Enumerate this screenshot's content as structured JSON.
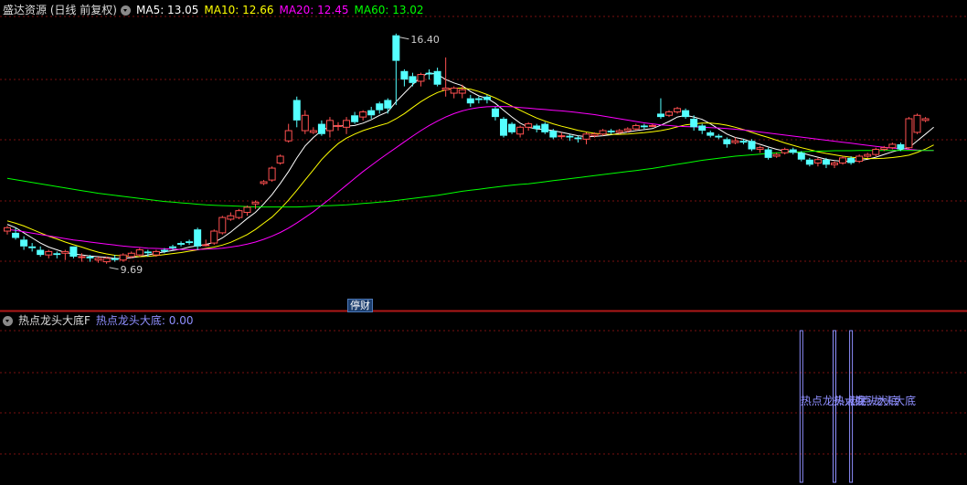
{
  "main_header": {
    "title": "盛达资源 (日线 前复权)",
    "ma": [
      {
        "label": "MA5: 13.05",
        "color": "#ffffff"
      },
      {
        "label": "MA10: 12.66",
        "color": "#ffff00"
      },
      {
        "label": "MA20: 12.45",
        "color": "#ff00ff"
      },
      {
        "label": "MA60: 13.02",
        "color": "#00ff00"
      }
    ]
  },
  "sub_header": {
    "indicator_name": "热点龙头大底F",
    "value_label": "热点龙头大底: 0.00",
    "value_color": "#8f8fff"
  },
  "badge": "停财",
  "signal_text": "热点龙头大底",
  "colors": {
    "up": "#ff5050",
    "down": "#54ffff",
    "grid": "#7a1010",
    "signal": "#8f8fff"
  },
  "chart_data": [
    {
      "type": "candlestick",
      "ylim": [
        8.8,
        16.9
      ],
      "max_label": "16.40",
      "min_label": "9.69",
      "candles": [
        [
          10.65,
          10.75,
          10.55,
          10.8
        ],
        [
          10.6,
          10.45,
          10.4,
          10.75
        ],
        [
          10.4,
          10.2,
          10.1,
          10.5
        ],
        [
          10.2,
          10.15,
          10.05,
          10.3
        ],
        [
          10.1,
          9.95,
          9.9,
          10.2
        ],
        [
          9.95,
          10.05,
          9.85,
          10.1
        ],
        [
          10.0,
          9.95,
          9.85,
          10.05
        ],
        [
          10.0,
          10.05,
          9.8,
          10.1
        ],
        [
          10.2,
          9.9,
          9.85,
          10.2
        ],
        [
          9.9,
          9.9,
          9.75,
          10.0
        ],
        [
          9.9,
          9.85,
          9.75,
          9.95
        ],
        [
          9.8,
          9.85,
          9.72,
          9.9
        ],
        [
          9.75,
          9.85,
          9.69,
          9.9
        ],
        [
          9.85,
          9.8,
          9.75,
          9.95
        ],
        [
          9.8,
          9.95,
          9.75,
          10.0
        ],
        [
          9.9,
          10.0,
          9.85,
          10.05
        ],
        [
          9.95,
          10.1,
          9.9,
          10.15
        ],
        [
          10.05,
          10.0,
          9.9,
          10.1
        ],
        [
          9.95,
          10.05,
          9.9,
          10.1
        ],
        [
          10.1,
          10.05,
          10.0,
          10.15
        ],
        [
          10.2,
          10.15,
          10.1,
          10.25
        ],
        [
          10.3,
          10.25,
          10.2,
          10.35
        ],
        [
          10.35,
          10.3,
          10.25,
          10.4
        ],
        [
          10.7,
          10.2,
          10.1,
          10.75
        ],
        [
          10.25,
          10.25,
          10.2,
          10.4
        ],
        [
          10.3,
          10.65,
          10.25,
          10.7
        ],
        [
          10.6,
          11.05,
          10.55,
          11.1
        ],
        [
          11.0,
          11.1,
          10.95,
          11.2
        ],
        [
          11.05,
          11.25,
          11.0,
          11.3
        ],
        [
          11.2,
          11.35,
          11.1,
          11.4
        ],
        [
          11.45,
          11.5,
          11.3,
          11.55
        ],
        [
          12.05,
          12.1,
          12.0,
          12.15
        ],
        [
          12.15,
          12.5,
          12.1,
          12.55
        ],
        [
          12.65,
          12.85,
          12.6,
          12.9
        ],
        [
          13.3,
          13.6,
          13.25,
          13.8
        ],
        [
          14.5,
          13.9,
          13.7,
          14.6
        ],
        [
          13.6,
          14.05,
          13.5,
          14.2
        ],
        [
          13.55,
          13.6,
          13.5,
          13.7
        ],
        [
          13.8,
          13.5,
          13.45,
          13.9
        ],
        [
          13.6,
          13.9,
          13.4,
          14.0
        ],
        [
          13.75,
          13.75,
          13.6,
          13.85
        ],
        [
          13.7,
          13.9,
          13.5,
          14.0
        ],
        [
          14.05,
          13.85,
          13.8,
          14.15
        ],
        [
          14.0,
          14.15,
          13.9,
          14.2
        ],
        [
          14.2,
          14.05,
          13.95,
          14.3
        ],
        [
          14.4,
          14.2,
          14.1,
          14.45
        ],
        [
          14.5,
          14.25,
          14.1,
          14.55
        ],
        [
          16.4,
          15.65,
          14.35,
          16.45
        ],
        [
          15.35,
          15.1,
          14.9,
          15.4
        ],
        [
          15.2,
          15.0,
          14.9,
          15.3
        ],
        [
          15.05,
          15.25,
          14.9,
          15.3
        ],
        [
          15.3,
          15.25,
          15.1,
          15.4
        ],
        [
          15.35,
          14.95,
          14.9,
          15.45
        ],
        [
          14.8,
          14.85,
          14.6,
          15.75
        ],
        [
          14.7,
          14.85,
          14.55,
          14.9
        ],
        [
          14.7,
          14.8,
          14.55,
          14.95
        ],
        [
          14.55,
          14.4,
          14.3,
          14.65
        ],
        [
          14.55,
          14.5,
          14.4,
          14.6
        ],
        [
          14.6,
          14.5,
          14.4,
          14.65
        ],
        [
          14.25,
          14.0,
          13.9,
          14.3
        ],
        [
          13.95,
          13.45,
          13.4,
          14.0
        ],
        [
          13.8,
          13.55,
          13.5,
          13.85
        ],
        [
          13.5,
          13.7,
          13.4,
          13.75
        ],
        [
          13.7,
          13.8,
          13.6,
          13.85
        ],
        [
          13.75,
          13.65,
          13.55,
          13.8
        ],
        [
          13.8,
          13.55,
          13.5,
          13.85
        ],
        [
          13.6,
          13.4,
          13.35,
          13.65
        ],
        [
          13.45,
          13.45,
          13.35,
          13.55
        ],
        [
          13.45,
          13.4,
          13.3,
          13.5
        ],
        [
          13.4,
          13.35,
          13.25,
          13.45
        ],
        [
          13.35,
          13.5,
          13.2,
          13.55
        ],
        [
          13.45,
          13.5,
          13.4,
          13.55
        ],
        [
          13.5,
          13.6,
          13.45,
          13.65
        ],
        [
          13.6,
          13.55,
          13.5,
          13.65
        ],
        [
          13.55,
          13.6,
          13.5,
          13.65
        ],
        [
          13.6,
          13.65,
          13.55,
          13.7
        ],
        [
          13.65,
          13.75,
          13.6,
          13.8
        ],
        [
          13.75,
          13.7,
          13.65,
          13.8
        ],
        [
          13.75,
          13.75,
          13.7,
          13.8
        ],
        [
          14.1,
          14.0,
          13.95,
          14.55
        ],
        [
          14.05,
          14.15,
          14.0,
          14.2
        ],
        [
          14.15,
          14.25,
          14.1,
          14.3
        ],
        [
          14.2,
          14.0,
          13.95,
          14.25
        ],
        [
          13.95,
          13.7,
          13.6,
          14.05
        ],
        [
          13.75,
          13.6,
          13.5,
          13.8
        ],
        [
          13.55,
          13.45,
          13.4,
          13.6
        ],
        [
          13.45,
          13.4,
          13.35,
          13.5
        ],
        [
          13.35,
          13.2,
          13.1,
          13.4
        ],
        [
          13.25,
          13.3,
          13.2,
          13.4
        ],
        [
          13.3,
          13.25,
          13.2,
          13.35
        ],
        [
          13.3,
          13.05,
          13.0,
          13.35
        ],
        [
          13.05,
          13.1,
          12.95,
          13.15
        ],
        [
          13.05,
          12.8,
          12.75,
          13.1
        ],
        [
          12.85,
          12.9,
          12.8,
          12.95
        ],
        [
          12.95,
          13.05,
          12.9,
          13.1
        ],
        [
          13.05,
          12.95,
          12.9,
          13.1
        ],
        [
          12.95,
          12.75,
          12.7,
          13.0
        ],
        [
          12.75,
          12.6,
          12.55,
          12.8
        ],
        [
          12.65,
          12.75,
          12.55,
          12.8
        ],
        [
          12.75,
          12.6,
          12.5,
          12.8
        ],
        [
          12.6,
          12.65,
          12.5,
          12.7
        ],
        [
          12.65,
          12.8,
          12.6,
          12.85
        ],
        [
          12.8,
          12.65,
          12.6,
          12.85
        ],
        [
          12.7,
          12.85,
          12.65,
          12.9
        ],
        [
          12.85,
          12.9,
          12.8,
          12.95
        ],
        [
          12.9,
          13.05,
          12.85,
          13.1
        ],
        [
          13.05,
          13.1,
          13.0,
          13.15
        ],
        [
          13.1,
          13.2,
          13.05,
          13.25
        ],
        [
          13.2,
          13.05,
          13.0,
          13.25
        ],
        [
          13.1,
          13.95,
          13.05,
          14.0
        ],
        [
          13.55,
          14.05,
          13.5,
          14.1
        ],
        [
          13.9,
          13.95,
          13.85,
          14.0
        ]
      ],
      "ma": [
        {
          "name": "MA5",
          "color": "#ffffff",
          "values": [
            10.85,
            10.75,
            10.6,
            10.45,
            10.3,
            10.18,
            10.1,
            10.02,
            9.98,
            9.95,
            9.92,
            9.9,
            9.88,
            9.85,
            9.85,
            9.87,
            9.9,
            9.95,
            10.0,
            10.04,
            10.08,
            10.12,
            10.18,
            10.22,
            10.26,
            10.32,
            10.45,
            10.62,
            10.82,
            11.02,
            11.2,
            11.45,
            11.72,
            12.05,
            12.4,
            12.8,
            13.15,
            13.4,
            13.6,
            13.72,
            13.75,
            13.73,
            13.75,
            13.82,
            13.92,
            14.05,
            14.15,
            14.45,
            14.7,
            14.95,
            15.18,
            15.3,
            15.25,
            15.1,
            15.0,
            14.92,
            14.75,
            14.62,
            14.55,
            14.4,
            14.2,
            14.0,
            13.82,
            13.7,
            13.65,
            13.63,
            13.6,
            13.55,
            13.5,
            13.45,
            13.42,
            13.43,
            13.45,
            13.48,
            13.52,
            13.56,
            13.6,
            13.63,
            13.66,
            13.76,
            13.87,
            14.0,
            14.05,
            14.0,
            13.93,
            13.8,
            13.65,
            13.5,
            13.4,
            13.35,
            13.27,
            13.2,
            13.12,
            13.05,
            13.0,
            12.98,
            12.95,
            12.88,
            12.82,
            12.76,
            12.72,
            12.7,
            12.7,
            12.72,
            12.76,
            12.82,
            12.9,
            12.98,
            13.04,
            13.1,
            13.3,
            13.5,
            13.7
          ]
        },
        {
          "name": "MA10",
          "color": "#ffff00",
          "values": [
            10.95,
            10.88,
            10.8,
            10.7,
            10.6,
            10.5,
            10.42,
            10.33,
            10.25,
            10.18,
            10.1,
            10.03,
            9.98,
            9.94,
            9.92,
            9.91,
            9.9,
            9.91,
            9.93,
            9.96,
            9.99,
            10.02,
            10.06,
            10.1,
            10.14,
            10.18,
            10.24,
            10.32,
            10.43,
            10.55,
            10.7,
            10.88,
            11.06,
            11.3,
            11.56,
            11.85,
            12.15,
            12.45,
            12.75,
            13.0,
            13.22,
            13.38,
            13.5,
            13.6,
            13.68,
            13.75,
            13.82,
            13.95,
            14.1,
            14.28,
            14.45,
            14.6,
            14.72,
            14.8,
            14.84,
            14.85,
            14.82,
            14.75,
            14.66,
            14.56,
            14.44,
            14.32,
            14.2,
            14.08,
            13.97,
            13.88,
            13.8,
            13.73,
            13.67,
            13.61,
            13.56,
            13.52,
            13.5,
            13.49,
            13.49,
            13.5,
            13.52,
            13.54,
            13.57,
            13.6,
            13.65,
            13.71,
            13.77,
            13.8,
            13.82,
            13.82,
            13.8,
            13.76,
            13.7,
            13.63,
            13.55,
            13.47,
            13.4,
            13.32,
            13.24,
            13.17,
            13.1,
            13.04,
            12.98,
            12.93,
            12.89,
            12.85,
            12.82,
            12.8,
            12.78,
            12.78,
            12.79,
            12.81,
            12.84,
            12.88,
            12.96,
            13.06,
            13.18
          ]
        },
        {
          "name": "MA20",
          "color": "#ff00ff",
          "values": [
            10.7,
            10.67,
            10.63,
            10.59,
            10.55,
            10.51,
            10.47,
            10.43,
            10.39,
            10.36,
            10.33,
            10.3,
            10.27,
            10.24,
            10.21,
            10.19,
            10.17,
            10.15,
            10.14,
            10.13,
            10.12,
            10.11,
            10.11,
            10.11,
            10.12,
            10.13,
            10.15,
            10.18,
            10.22,
            10.27,
            10.33,
            10.41,
            10.5,
            10.61,
            10.74,
            10.89,
            11.05,
            11.22,
            11.41,
            11.6,
            11.8,
            12.0,
            12.2,
            12.4,
            12.58,
            12.76,
            12.93,
            13.1,
            13.27,
            13.44,
            13.6,
            13.75,
            13.88,
            14.0,
            14.1,
            14.18,
            14.24,
            14.28,
            14.3,
            14.31,
            14.31,
            14.3,
            14.28,
            14.26,
            14.24,
            14.22,
            14.2,
            14.18,
            14.16,
            14.13,
            14.1,
            14.07,
            14.03,
            13.99,
            13.95,
            13.91,
            13.87,
            13.83,
            13.8,
            13.77,
            13.75,
            13.73,
            13.72,
            13.71,
            13.7,
            13.69,
            13.68,
            13.66,
            13.64,
            13.62,
            13.59,
            13.56,
            13.53,
            13.5,
            13.47,
            13.44,
            13.41,
            13.38,
            13.35,
            13.32,
            13.29,
            13.26,
            13.23,
            13.2,
            13.17,
            13.14,
            13.11,
            13.09,
            13.07,
            13.05,
            13.03,
            13.02,
            13.02
          ]
        },
        {
          "name": "MA60",
          "color": "#00ff00",
          "values": [
            12.2,
            12.16,
            12.12,
            12.08,
            12.04,
            12.0,
            11.96,
            11.92,
            11.88,
            11.84,
            11.8,
            11.76,
            11.73,
            11.7,
            11.67,
            11.64,
            11.61,
            11.58,
            11.55,
            11.52,
            11.5,
            11.48,
            11.46,
            11.44,
            11.42,
            11.41,
            11.4,
            11.39,
            11.38,
            11.37,
            11.36,
            11.36,
            11.36,
            11.36,
            11.36,
            11.36,
            11.37,
            11.38,
            11.39,
            11.4,
            11.41,
            11.42,
            11.44,
            11.46,
            11.48,
            11.5,
            11.52,
            11.55,
            11.58,
            11.61,
            11.64,
            11.67,
            11.7,
            11.74,
            11.78,
            11.82,
            11.85,
            11.88,
            11.91,
            11.94,
            11.97,
            12.0,
            12.02,
            12.04,
            12.07,
            12.1,
            12.13,
            12.16,
            12.19,
            12.22,
            12.25,
            12.28,
            12.31,
            12.34,
            12.37,
            12.4,
            12.43,
            12.46,
            12.49,
            12.53,
            12.57,
            12.61,
            12.65,
            12.69,
            12.73,
            12.76,
            12.79,
            12.82,
            12.85,
            12.87,
            12.89,
            12.91,
            12.93,
            12.95,
            12.96,
            12.97,
            12.98,
            12.99,
            13.0,
            13.0,
            13.01,
            13.01,
            13.01,
            13.02,
            13.02,
            13.02,
            13.02,
            13.02,
            13.02,
            13.02,
            13.02,
            13.02,
            13.02
          ]
        }
      ]
    },
    {
      "type": "signal",
      "name": "热点龙头大底",
      "signal_indices": [
        96,
        100,
        102
      ]
    }
  ]
}
